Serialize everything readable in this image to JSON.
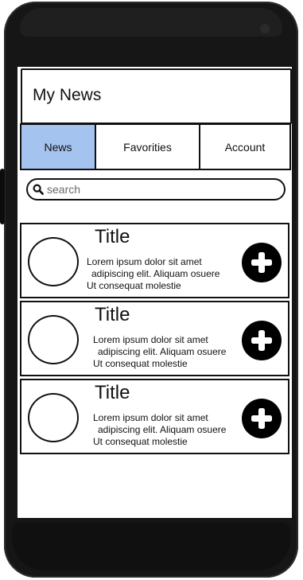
{
  "app": {
    "title": "My News"
  },
  "tabs": [
    {
      "label": "News",
      "active": true
    },
    {
      "label": "Favorities",
      "active": false
    },
    {
      "label": "Account",
      "active": false
    }
  ],
  "search": {
    "placeholder": "search",
    "icon": "search-icon"
  },
  "articles": [
    {
      "title": "Title",
      "lines": [
        "Lorem ipsum dolor sit amet",
        "adipiscing elit. Aliquam osuere",
        "Ut consequat molestie"
      ],
      "action_icon": "plus-circle-icon"
    },
    {
      "title": "Title",
      "lines": [
        "Lorem ipsum dolor sit amet",
        "adipiscing elit. Aliquam osuere",
        "Ut consequat molestie"
      ],
      "action_icon": "plus-circle-icon"
    },
    {
      "title": "Title",
      "lines": [
        "Lorem ipsum dolor sit amet",
        "adipiscing elit. Aliquam osuere",
        "Ut consequat molestie"
      ],
      "action_icon": "plus-circle-icon"
    }
  ],
  "colors": {
    "active_tab": "#a4c3ef",
    "device_frame": "#161616",
    "ink": "#111111"
  }
}
